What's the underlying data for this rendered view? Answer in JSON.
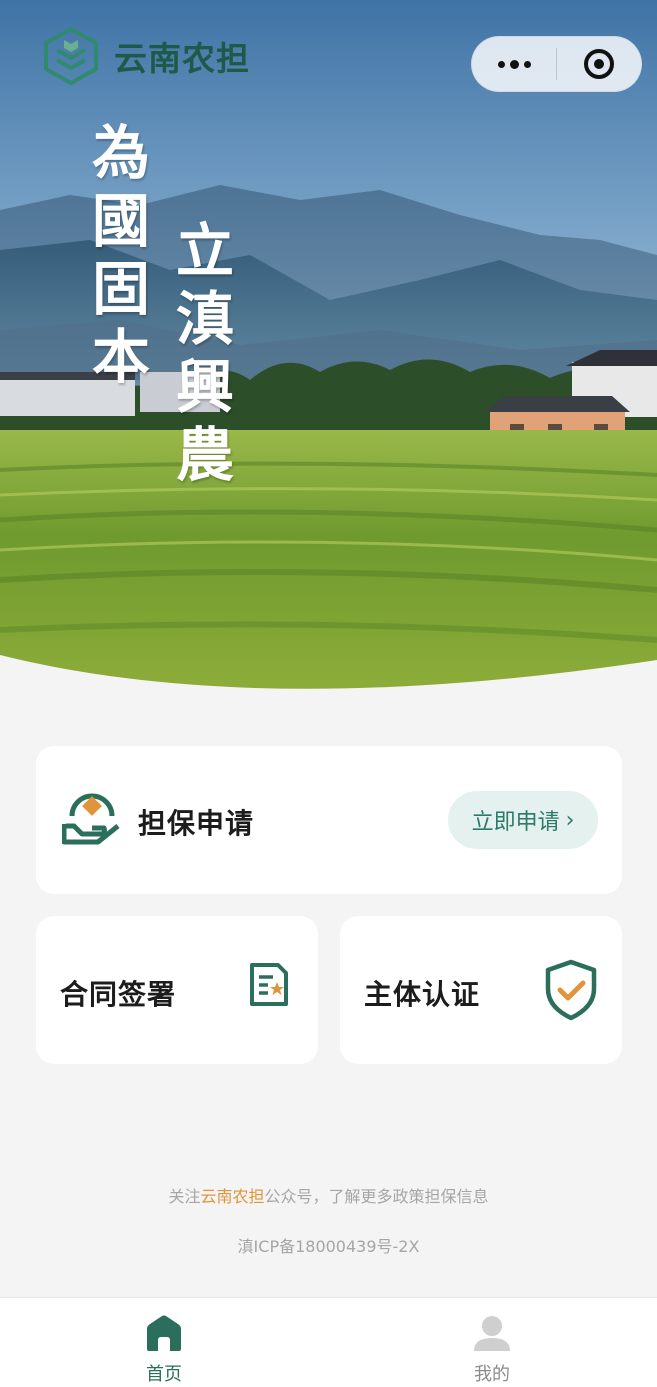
{
  "header": {
    "brand_name": "云南农担",
    "logo_icon": "wheat-hexagon-logo-icon",
    "capsule_more_icon": "more-dots-icon",
    "capsule_close_icon": "target-circle-icon"
  },
  "hero": {
    "calligraphy_left": "為國固本",
    "calligraphy_right": "立滇興農"
  },
  "cards": {
    "apply": {
      "title": "担保申请",
      "button_label": "立即申请",
      "icon": "hand-coin-icon"
    },
    "contract": {
      "title": "合同签署",
      "icon": "contract-document-icon"
    },
    "auth": {
      "title": "主体认证",
      "icon": "shield-check-icon"
    }
  },
  "footer": {
    "notice_prefix": "关注",
    "notice_highlight": "云南农担",
    "notice_suffix": "公众号，了解更多政策担保信息",
    "icp": "滇ICP备18000439号-2X"
  },
  "tabbar": {
    "items": [
      {
        "label": "首页",
        "icon": "home-icon",
        "active": true
      },
      {
        "label": "我的",
        "icon": "user-icon",
        "active": false
      }
    ]
  },
  "colors": {
    "brand_green": "#2b6e5c",
    "accent_orange": "#e0953a",
    "page_background": "#f4f4f4"
  }
}
